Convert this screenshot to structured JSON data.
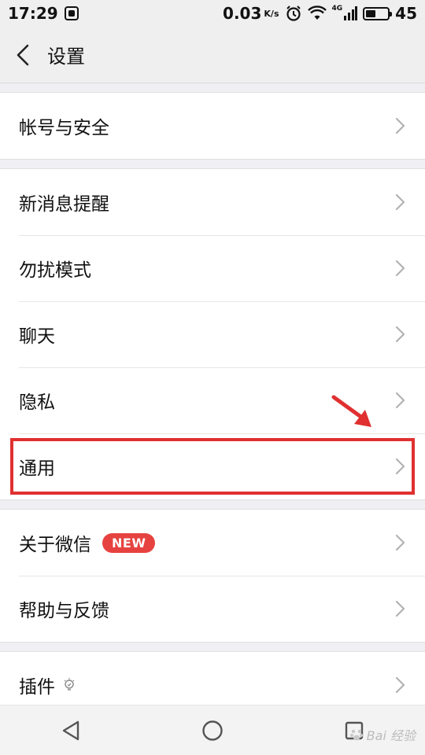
{
  "status_bar": {
    "time": "17:29",
    "net_speed": "0.03",
    "net_speed_unit": "K/s",
    "network_type": "4G",
    "battery": "45",
    "battery_level_pct": 45
  },
  "header": {
    "title": "设置"
  },
  "groups": [
    {
      "items": [
        {
          "label": "帐号与安全"
        }
      ]
    },
    {
      "items": [
        {
          "label": "新消息提醒"
        },
        {
          "label": "勿扰模式"
        },
        {
          "label": "聊天"
        },
        {
          "label": "隐私"
        },
        {
          "label": "通用"
        }
      ]
    },
    {
      "items": [
        {
          "label": "关于微信",
          "badge": "NEW"
        },
        {
          "label": "帮助与反馈"
        }
      ]
    },
    {
      "items": [
        {
          "label": "插件"
        }
      ]
    }
  ],
  "annotation": {
    "highlighted_item": "通用",
    "highlight_color": "#e03030"
  },
  "watermark": {
    "text": "Bai 经验"
  },
  "colors": {
    "badge": "#e64340",
    "background": "#efeff4",
    "chevron": "#b2b2b2"
  }
}
